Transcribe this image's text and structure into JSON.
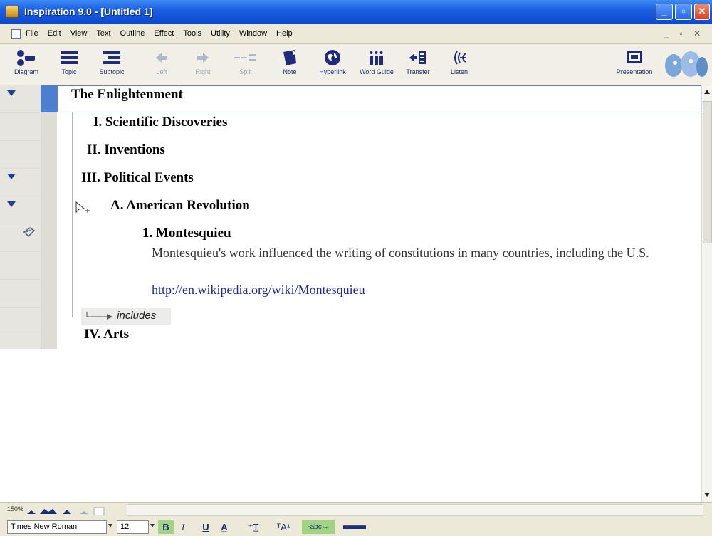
{
  "window": {
    "title": "Inspiration 9.0 - [Untitled 1]"
  },
  "menu": [
    "File",
    "Edit",
    "View",
    "Text",
    "Outline",
    "Effect",
    "Tools",
    "Utility",
    "Window",
    "Help"
  ],
  "toolbar": {
    "diagram": "Diagram",
    "topic": "Topic",
    "subtopic": "Subtopic",
    "left": "Left",
    "right": "Right",
    "split": "Split",
    "note": "Note",
    "hyperlink": "Hyperlink",
    "word_guide": "Word Guide",
    "transfer": "Transfer",
    "listen": "Listen",
    "presentation": "Presentation"
  },
  "outline": {
    "main": "The Enlightenment",
    "t1": "I.  Scientific Discoveries",
    "t2": "II.  Inventions",
    "t3": "III.  Political Events",
    "t3a": "A.  American Revolution",
    "t3a1": "1.  Montesquieu",
    "note": "Montesquieu's work influenced the writing of constitutions in many countries, including the U.S.",
    "link": "http://en.wikipedia.org/wiki/Montesquieu",
    "relation": "includes",
    "t4": "IV.  Arts"
  },
  "status": {
    "zoom": "150%"
  },
  "format": {
    "font": "Times New Roman",
    "size": "12"
  }
}
